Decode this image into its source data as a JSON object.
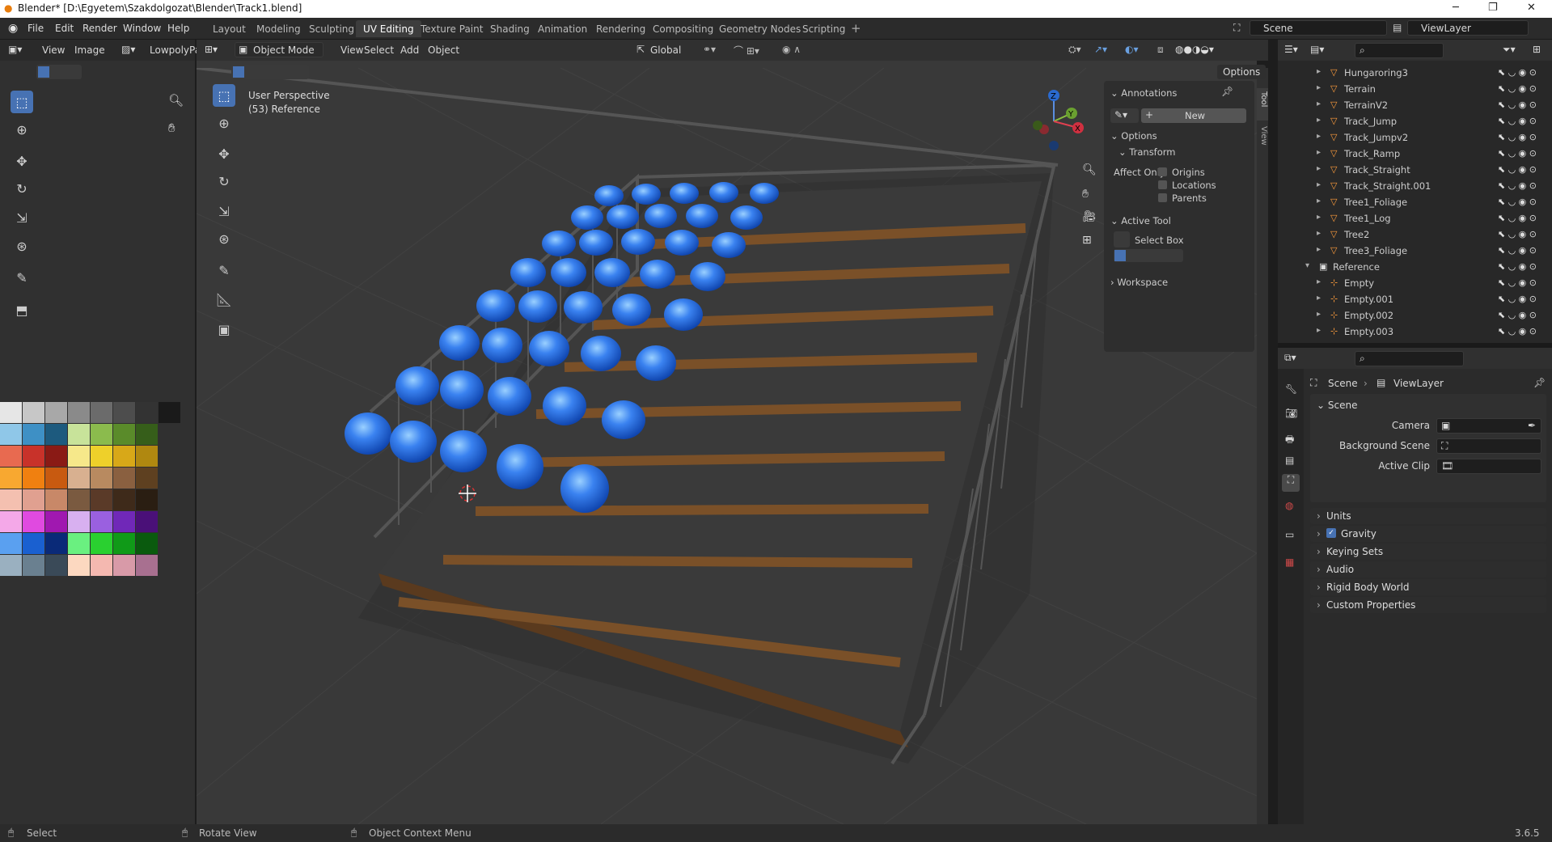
{
  "titlebar": {
    "title": "Blender* [D:\\Egyetem\\Szakdolgozat\\Blender\\Track1.blend]"
  },
  "menu": [
    "File",
    "Edit",
    "Render",
    "Window",
    "Help"
  ],
  "workspaces": [
    "Layout",
    "Modeling",
    "Sculpting",
    "UV Editing",
    "Texture Paint",
    "Shading",
    "Animation",
    "Rendering",
    "Compositing",
    "Geometry Nodes",
    "Scripting"
  ],
  "active_workspace": "UV Editing",
  "scene_name": "Scene",
  "view_layer": "ViewLayer",
  "uv_editor": {
    "view": "View",
    "image": "Image",
    "image_name": "LowpolyPa"
  },
  "viewport": {
    "mode": "Object Mode",
    "menus": [
      "View",
      "Select",
      "Add",
      "Object"
    ],
    "orientation": "Global",
    "options": "Options",
    "overlay_line1": "User Perspective",
    "overlay_line2": "(53) Reference"
  },
  "npanel": {
    "tabs": [
      "Tool",
      "View"
    ],
    "annotations": "Annotations",
    "new_btn": "New",
    "options": "Options",
    "transform": "Transform",
    "affect_only": "Affect Only",
    "origins": "Origins",
    "locations": "Locations",
    "parents": "Parents",
    "active_tool": "Active Tool",
    "select_box": "Select Box",
    "workspace": "Workspace"
  },
  "outliner": {
    "items": [
      {
        "name": "Hungaroring3",
        "type": "mesh"
      },
      {
        "name": "Terrain",
        "type": "mesh"
      },
      {
        "name": "TerrainV2",
        "type": "mesh"
      },
      {
        "name": "Track_Jump",
        "type": "mesh"
      },
      {
        "name": "Track_Jumpv2",
        "type": "mesh"
      },
      {
        "name": "Track_Ramp",
        "type": "mesh"
      },
      {
        "name": "Track_Straight",
        "type": "mesh"
      },
      {
        "name": "Track_Straight.001",
        "type": "mesh"
      },
      {
        "name": "Tree1_Foliage",
        "type": "mesh"
      },
      {
        "name": "Tree1_Log",
        "type": "mesh"
      },
      {
        "name": "Tree2",
        "type": "mesh"
      },
      {
        "name": "Tree3_Foliage",
        "type": "mesh"
      },
      {
        "name": "Reference",
        "type": "collection"
      },
      {
        "name": "Empty",
        "type": "empty"
      },
      {
        "name": "Empty.001",
        "type": "empty"
      },
      {
        "name": "Empty.002",
        "type": "empty"
      },
      {
        "name": "Empty.003",
        "type": "empty"
      }
    ]
  },
  "properties": {
    "breadcrumb_scene": "Scene",
    "breadcrumb_layer": "ViewLayer",
    "section": "Scene",
    "camera": "Camera",
    "background_scene": "Background Scene",
    "active_clip": "Active Clip",
    "panels": [
      "Units",
      "Gravity",
      "Keying Sets",
      "Audio",
      "Rigid Body World",
      "Custom Properties"
    ]
  },
  "statusbar": {
    "select": "Select",
    "rotate": "Rotate View",
    "context": "Object Context Menu",
    "version": "3.6.5"
  }
}
